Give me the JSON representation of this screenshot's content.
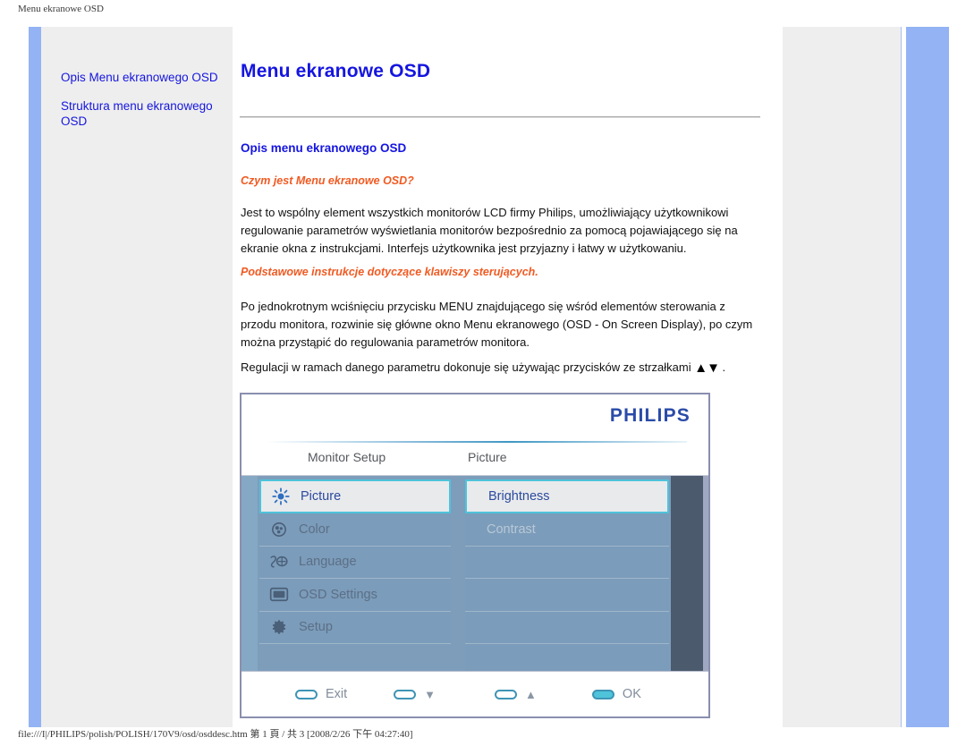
{
  "browser": {
    "header_title": "Menu ekranowe OSD",
    "footer_status": "file:///I|/PHILIPS/polish/POLISH/170V9/osd/osddesc.htm 第 1 頁 / 共 3 [2008/2/26 下午 04:27:40]"
  },
  "sidebar": {
    "items": [
      {
        "label": "Opis Menu ekranowego OSD"
      },
      {
        "label": "Struktura menu ekranowego OSD"
      }
    ]
  },
  "main": {
    "title": "Menu ekranowe OSD",
    "section_title": "Opis menu ekranowego OSD",
    "sub_head_1": "Czym jest Menu ekranowe OSD?",
    "paragraph_1": "Jest to wspólny element wszystkich monitorów LCD firmy Philips, umożliwiający użytkownikowi regulowanie parametrów wyświetlania monitorów bezpośrednio za pomocą pojawiającego się na ekranie okna z instrukcjami. Interfejs użytkownika jest przyjazny i łatwy w użytkowaniu.",
    "sub_head_2": "Podstawowe instrukcje dotyczące klawiszy sterujących.",
    "paragraph_2": "Po jednokrotnym wciśnięciu przycisku MENU znajdującego się wśród elementów sterowania z przodu monitora, rozwinie się główne okno Menu ekranowego (OSD - On Screen Display), po czym można przystąpić do regulowania parametrów monitora.",
    "paragraph_3_before": "Regulacji w ramach danego parametru dokonuje się używając przycisków ze strzałkami ",
    "paragraph_3_arrows": "▲▼",
    "paragraph_3_after": " ."
  },
  "osd": {
    "brand": "PHILIPS",
    "tab_left": "Monitor Setup",
    "tab_right": "Picture",
    "menu_items": [
      {
        "label": "Picture",
        "icon": "brightness-sun-icon",
        "selected": true
      },
      {
        "label": "Color",
        "icon": "color-wheel-icon",
        "selected": false
      },
      {
        "label": "Language",
        "icon": "language-icon",
        "selected": false
      },
      {
        "label": "OSD Settings",
        "icon": "monitor-icon",
        "selected": false
      },
      {
        "label": "Setup",
        "icon": "gear-icon",
        "selected": false
      }
    ],
    "option_items": [
      {
        "label": "Brightness",
        "selected": true
      },
      {
        "label": "Contrast",
        "selected": false
      },
      {
        "label": "",
        "selected": false
      },
      {
        "label": "",
        "selected": false
      },
      {
        "label": "",
        "selected": false
      },
      {
        "label": "",
        "selected": false
      }
    ],
    "buttons": [
      {
        "label": "Exit",
        "glyph": "",
        "filled": false
      },
      {
        "label": "",
        "glyph": "▼",
        "filled": false
      },
      {
        "label": "",
        "glyph": "▲",
        "filled": false
      },
      {
        "label": "OK",
        "glyph": "",
        "filled": true
      }
    ]
  },
  "colors": {
    "link_blue": "#1515e0",
    "heading_orange": "#f15a22",
    "philips_blue": "#2a4ba8",
    "rail_blue": "#94b3f4",
    "osd_body": "#7d9dbb",
    "osd_accent_cyan": "#4ec3da"
  }
}
